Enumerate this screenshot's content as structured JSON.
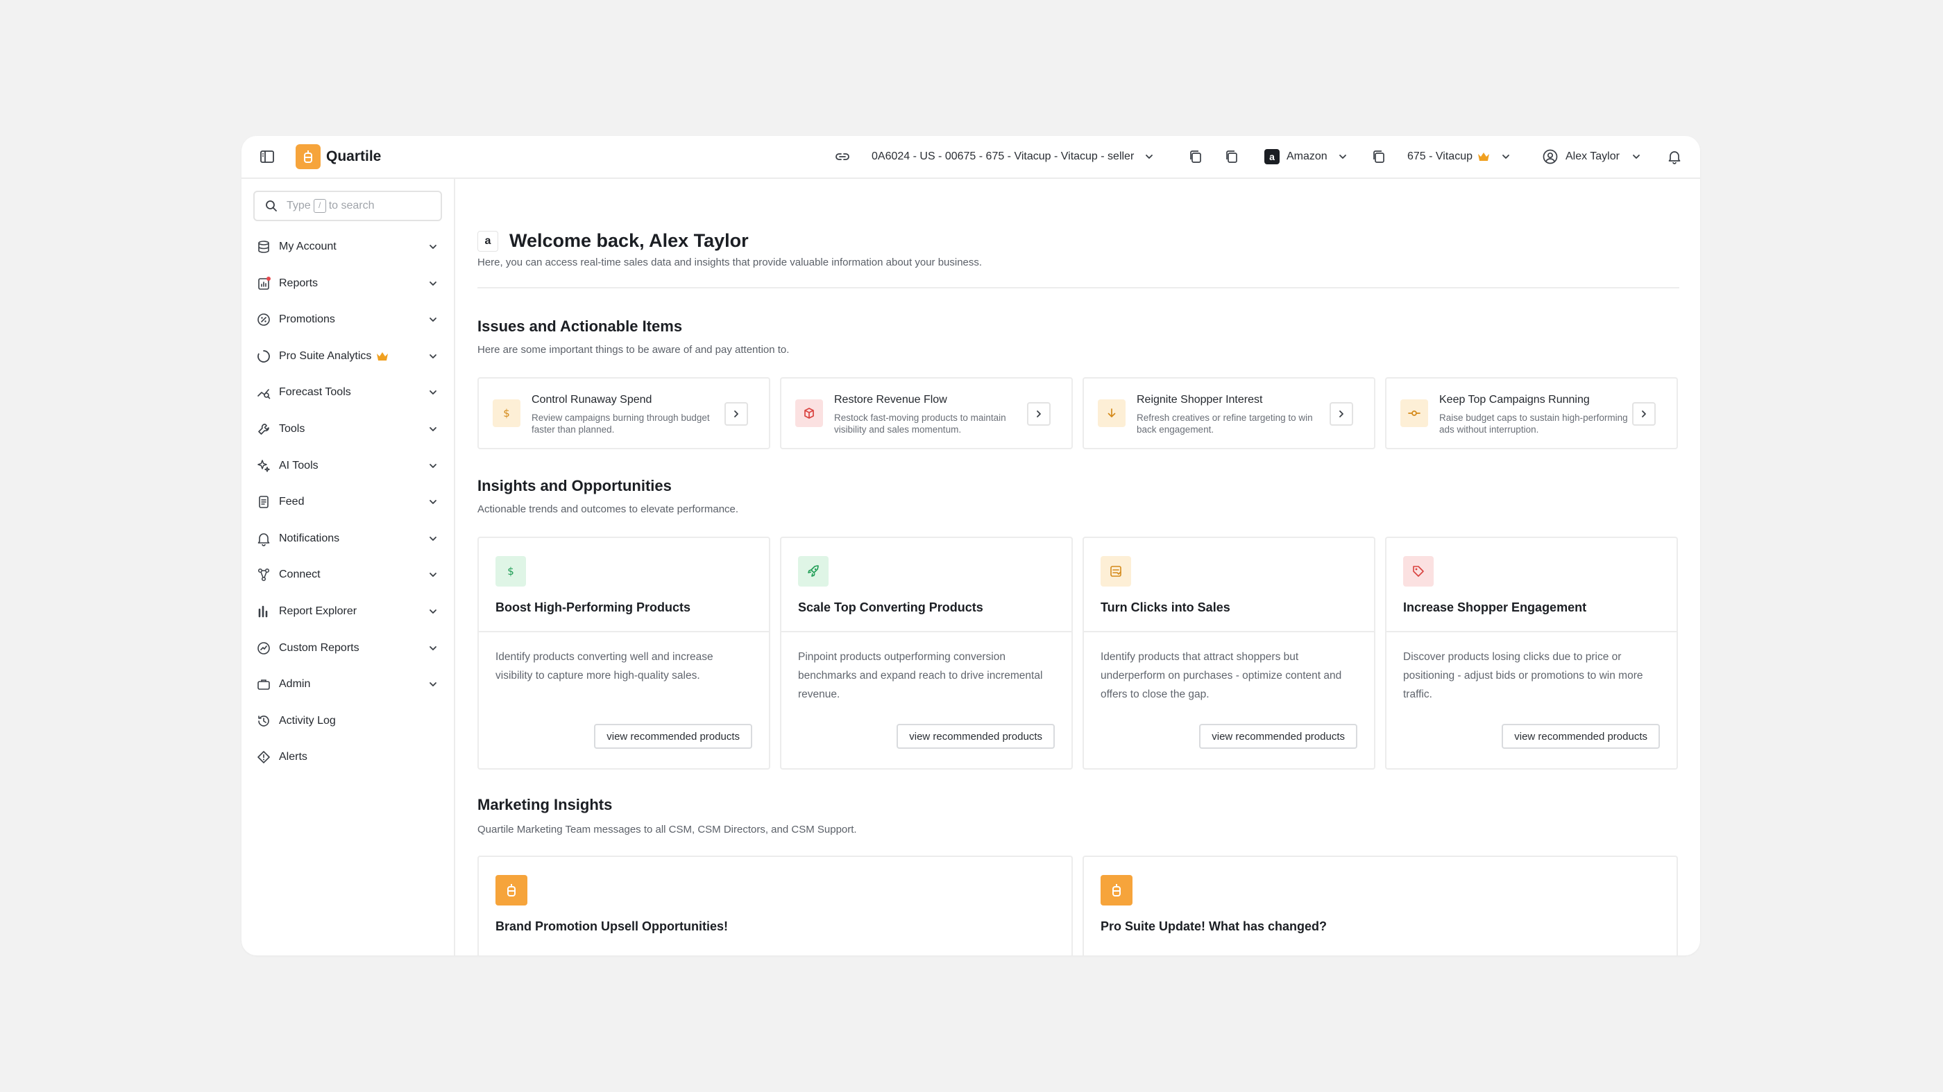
{
  "topbar": {
    "brand": "Quartile",
    "account_string": "0A6024 - US - 00675 - 675 - Vitacup - Vitacup - seller",
    "marketplace": "Amazon",
    "brand_selector": "675 - Vitacup",
    "user": "Alex Taylor"
  },
  "sidebar": {
    "search_prefix": "Type",
    "search_key": "/",
    "search_suffix": "to search",
    "items": [
      {
        "label": "My Account",
        "icon": "database-icon"
      },
      {
        "label": "Reports",
        "icon": "report-icon"
      },
      {
        "label": "Promotions",
        "icon": "percent-icon"
      },
      {
        "label": "Pro Suite Analytics",
        "icon": "circle-progress-icon"
      },
      {
        "label": "Forecast Tools",
        "icon": "forecast-icon"
      },
      {
        "label": "Tools",
        "icon": "wrench-icon"
      },
      {
        "label": "AI Tools",
        "icon": "sparkles-icon"
      },
      {
        "label": "Feed",
        "icon": "document-icon"
      },
      {
        "label": "Notifications",
        "icon": "bell-icon"
      },
      {
        "label": "Connect",
        "icon": "connect-icon"
      },
      {
        "label": "Report Explorer",
        "icon": "bar-chart-icon"
      },
      {
        "label": "Custom Reports",
        "icon": "custom-report-icon"
      },
      {
        "label": "Admin",
        "icon": "briefcase-icon"
      },
      {
        "label": "Activity Log",
        "icon": "history-icon"
      },
      {
        "label": "Alerts",
        "icon": "diamond-alert-icon"
      }
    ]
  },
  "welcome": {
    "title": "Welcome back, Alex Taylor",
    "subtitle": "Here, you can access real-time sales data and insights that provide valuable information about your business."
  },
  "issues": {
    "title": "Issues and Actionable Items",
    "subtitle": "Here are some important things to be aware of and pay attention to.",
    "cards": [
      {
        "title": "Control Runaway Spend",
        "desc": "Review campaigns burning through budget faster than planned."
      },
      {
        "title": "Restore Revenue Flow",
        "desc": "Restock fast-moving products to maintain visibility and sales momentum."
      },
      {
        "title": "Reignite Shopper Interest",
        "desc": "Refresh creatives or refine targeting to win back engagement."
      },
      {
        "title": "Keep Top Campaigns Running",
        "desc": "Raise budget caps to sustain high-performing ads without interruption."
      }
    ]
  },
  "insights": {
    "title": "Insights and Opportunities",
    "subtitle": "Actionable trends and outcomes to elevate performance.",
    "cards": [
      {
        "title": "Boost High-Performing Products",
        "desc": "Identify products converting well and increase visibility to capture more high-quality sales.",
        "button": "view recommended products"
      },
      {
        "title": "Scale Top Converting Products",
        "desc": "Pinpoint products outperforming conversion benchmarks and expand reach to drive incremental revenue.",
        "button": "view recommended products"
      },
      {
        "title": "Turn Clicks into Sales",
        "desc": "Identify products that attract shoppers but underperform on purchases - optimize content and offers to close the gap.",
        "button": "view recommended products"
      },
      {
        "title": "Increase Shopper Engagement",
        "desc": "Discover products losing clicks due to price or positioning - adjust bids or promotions to win more traffic.",
        "button": "view recommended products"
      }
    ]
  },
  "marketing": {
    "title": "Marketing Insights",
    "subtitle": "Quartile Marketing Team messages to all CSM, CSM Directors, and CSM Support.",
    "cards": [
      {
        "title": "Brand Promotion Upsell Opportunities!"
      },
      {
        "title": "Pro Suite Update! What has changed?"
      }
    ]
  },
  "colors": {
    "brand_orange": "#f6a43b",
    "crown": "#f0a020",
    "issue_orange_bg": "#fdefd6",
    "issue_red_bg": "#fbe1e1",
    "insight_green_bg": "#dff5e6",
    "insight_orange_bg": "#fdefd6",
    "insight_red_bg": "#fbe1e1"
  }
}
